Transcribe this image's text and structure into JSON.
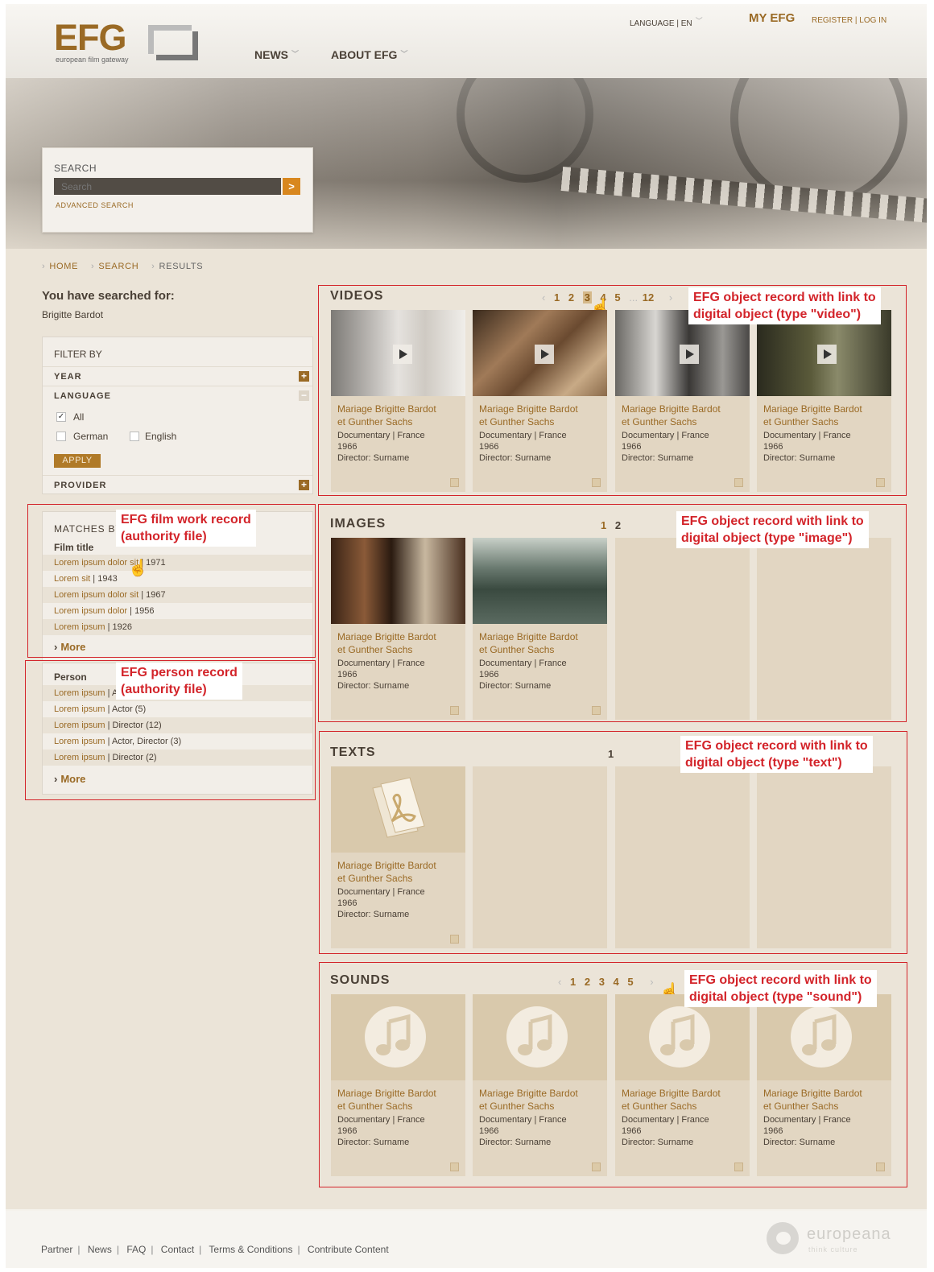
{
  "header": {
    "logo_text": "EFG",
    "logo_subtitle": "european film gateway",
    "nav": [
      {
        "label": "NEWS"
      },
      {
        "label": "ABOUT EFG"
      }
    ],
    "language": "LANGUAGE | EN",
    "my_efg": "MY EFG",
    "register_login": "REGISTER | LOG IN"
  },
  "search": {
    "label": "SEARCH",
    "placeholder": "Search",
    "button": ">",
    "advanced": "ADVANCED SEARCH"
  },
  "breadcrumb": {
    "items": [
      {
        "label": "HOME"
      },
      {
        "label": "SEARCH"
      },
      {
        "label": "RESULTS"
      }
    ]
  },
  "sidebar": {
    "searched_label": "You have searched for:",
    "searched_term": "Brigitte Bardot",
    "filter": {
      "title": "FILTER BY",
      "year": "YEAR",
      "language": "LANGUAGE",
      "options": [
        {
          "label": "All",
          "checked": true
        },
        {
          "label": "German",
          "checked": false
        },
        {
          "label": "English",
          "checked": false
        }
      ],
      "apply": "APPLY",
      "provider": "PROVIDER"
    },
    "matches": {
      "title": "MATCHES BY",
      "film_title": "Film title",
      "films": [
        {
          "title": "Lorem ipsum dolor sit",
          "year": " | 1971"
        },
        {
          "title": "Lorem sit",
          "year": " | 1943"
        },
        {
          "title": "Lorem ipsum dolor sit",
          "year": " | 1967"
        },
        {
          "title": "Lorem ipsum dolor",
          "year": " | 1956"
        },
        {
          "title": "Lorem ipsum",
          "year": " | 1926"
        }
      ],
      "more": "More"
    },
    "persons": {
      "title": "Person",
      "items": [
        {
          "name": "Lorem ipsum",
          "role": " | A"
        },
        {
          "name": "Lorem ipsum",
          "role": " | Actor (5)"
        },
        {
          "name": "Lorem ipsum",
          "role": " | Director (12)"
        },
        {
          "name": "Lorem ipsum",
          "role": " | Actor, Director (3)"
        },
        {
          "name": "Lorem ipsum",
          "role": " | Director (2)"
        }
      ],
      "more": "More"
    }
  },
  "card_text": {
    "title_line1": "Mariage Brigitte Bardot",
    "title_line2": "et Gunther Sachs",
    "genre": "Documentary | France",
    "year": "1966",
    "director": "Director: Surname"
  },
  "sections": {
    "videos": {
      "title": "VIDEOS",
      "pager": [
        "1",
        "2",
        "3",
        "4",
        "5",
        "...",
        "12"
      ],
      "current": "3"
    },
    "images": {
      "title": "IMAGES",
      "pager": [
        "1",
        "2"
      ]
    },
    "texts": {
      "title": "TEXTS",
      "pager": [
        "1"
      ]
    },
    "sounds": {
      "title": "SOUNDS",
      "pager": [
        "1",
        "2",
        "3",
        "4",
        "5"
      ]
    }
  },
  "annotations": {
    "videos": [
      "EFG object record with link to",
      "digital object (type \"video\")"
    ],
    "images": [
      "EFG object record with link to",
      "digital object (type \"image\")"
    ],
    "texts": [
      "EFG object record with link to",
      "digital object (type \"text\")"
    ],
    "sounds": [
      "EFG object record with link to",
      "digital object (type \"sound\")"
    ],
    "film": [
      "EFG film work record",
      "(authority file)"
    ],
    "person": [
      "EFG person record",
      "(authority file)"
    ]
  },
  "footer": {
    "links": [
      {
        "label": "Partner"
      },
      {
        "label": "News"
      },
      {
        "label": "FAQ"
      },
      {
        "label": "Contact"
      },
      {
        "label": "Terms & Conditions"
      },
      {
        "label": "Contribute Content"
      }
    ],
    "logo_word": "europeana",
    "logo_sub": "think culture"
  },
  "colors": {
    "accent": "#9a6a25",
    "annotation": "#d3242a",
    "background": "#ebe4d8",
    "card": "#e2d6c2"
  }
}
